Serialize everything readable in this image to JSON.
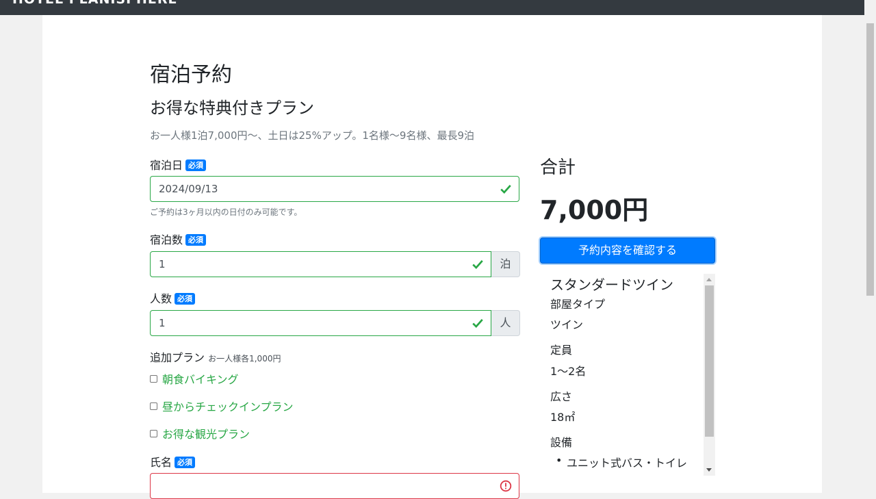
{
  "navbar": {
    "brand": "HOTEL PLANISPHERE"
  },
  "page": {
    "title": "宿泊予約",
    "plan_name": "お得な特典付きプラン",
    "plan_desc": "お一人様1泊7,000円〜、土日は25%アップ。1名様〜9名様、最長9泊"
  },
  "form": {
    "required_badge": "必須",
    "date": {
      "label": "宿泊日",
      "value": "2024/09/13",
      "help": "ご予約は3ヶ月以内の日付のみ可能です。"
    },
    "term": {
      "label": "宿泊数",
      "value": "1",
      "unit": "泊"
    },
    "head_count": {
      "label": "人数",
      "value": "1",
      "unit": "人"
    },
    "plans": {
      "label": "追加プラン",
      "note": "お一人様各1,000円",
      "options": [
        {
          "label": "朝食バイキング",
          "checked": false
        },
        {
          "label": "昼からチェックインプラン",
          "checked": false
        },
        {
          "label": "お得な観光プラン",
          "checked": false
        }
      ]
    },
    "username": {
      "label": "氏名",
      "value": ""
    }
  },
  "summary": {
    "total_label": "合計",
    "total_price": "7,000円",
    "confirm_button": "予約内容を確認する"
  },
  "room": {
    "title": "スタンダードツイン",
    "type_label": "部屋タイプ",
    "type_value": "ツイン",
    "capacity_label": "定員",
    "capacity_value": "1〜2名",
    "size_label": "広さ",
    "size_value": "18㎡",
    "facilities_label": "設備",
    "facilities": [
      "ユニット式バス・トイレ"
    ]
  },
  "colors": {
    "valid": "#28a745",
    "invalid": "#dc3545",
    "primary": "#007bff"
  }
}
